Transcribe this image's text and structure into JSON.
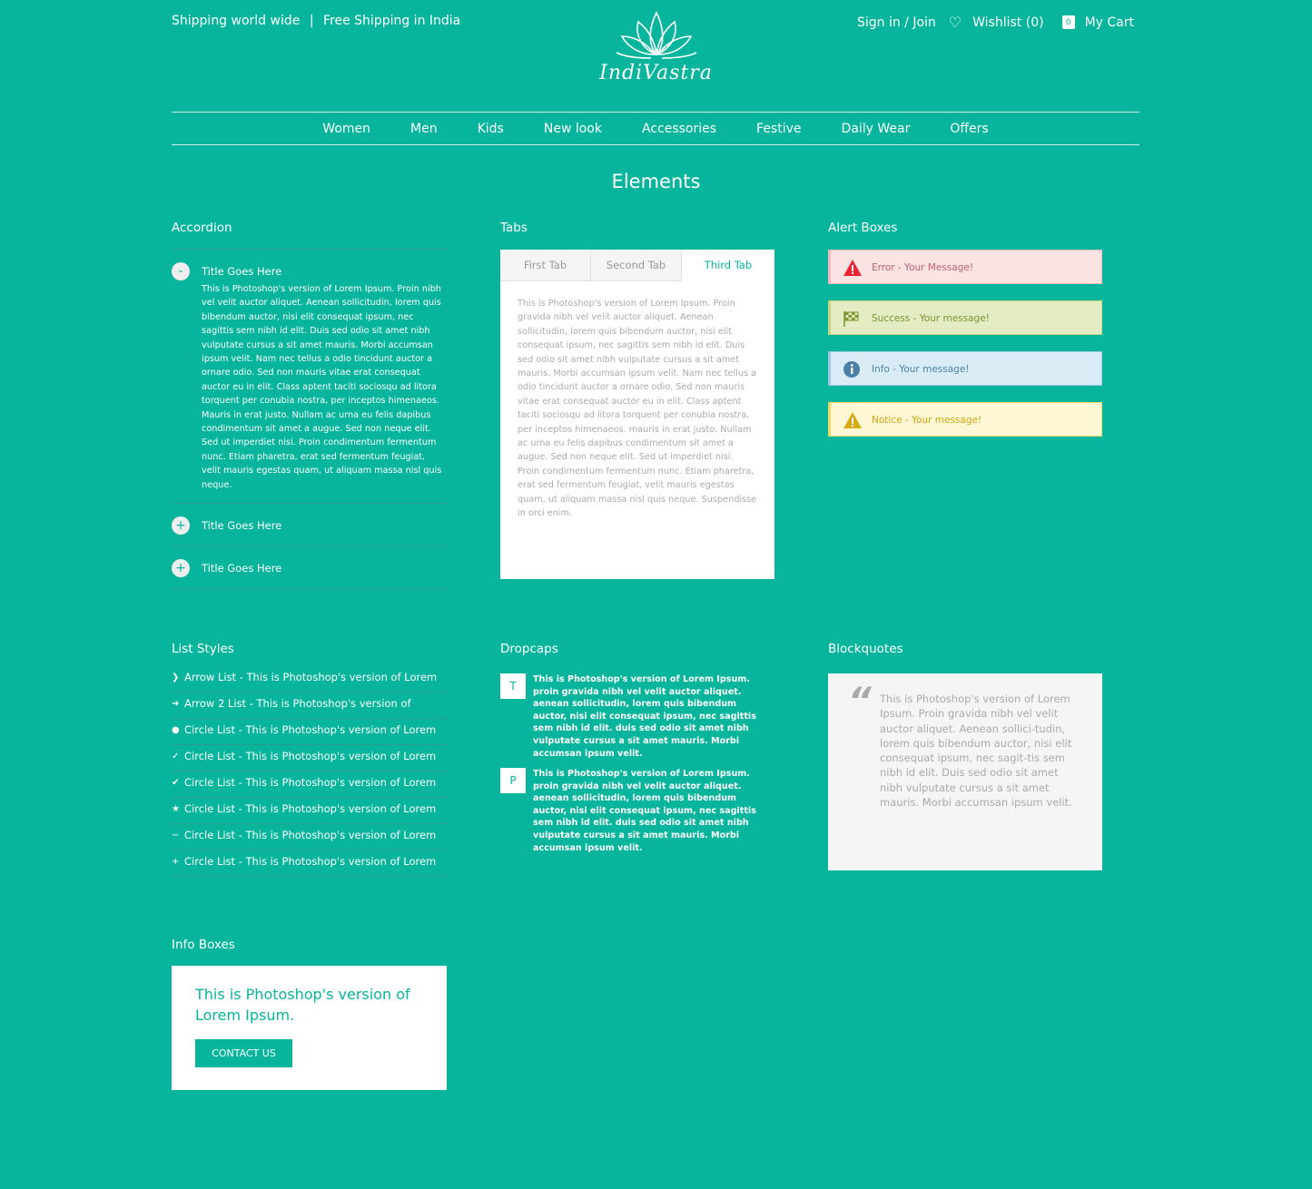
{
  "header": {
    "shipping": "Shipping world wide",
    "separator": "|",
    "free_shipping": "Free Shipping in India",
    "brand": "IndiVastra",
    "signin": "Sign in / Join",
    "wishlist": "Wishlist (0)",
    "cart_count": "0",
    "cart": "My Cart"
  },
  "nav": [
    "Women",
    "Men",
    "Kids",
    "New look",
    "Accessories",
    "Festive",
    "Daily Wear",
    "Offers"
  ],
  "page_title": "Elements",
  "accordion": {
    "heading": "Accordion",
    "items": [
      {
        "icon": "-",
        "title": "Title Goes Here",
        "body": "This is Photoshop's version  of Lorem Ipsum. Proin nibh vel velit auctor aliquet. Aenean sollicitudin, lorem quis bibendum auctor, nisi elit consequat ipsum, nec sagittis sem nibh id elit. Duis sed odio sit amet nibh vulputate cursus a sit amet mauris. Morbi accumsan ipsum velit. Nam nec tellus a odio tincidunt auctor a ornare odio. Sed non  mauris vitae erat consequat auctor eu in elit. Class aptent taciti sociosqu ad litora torquent per conubia nostra, per inceptos himenaeos. Mauris in erat justo. Nullam ac urna eu felis dapibus condimentum sit amet a augue. Sed non neque elit. Sed ut imperdiet nisi. Proin condimentum fermentum nunc. Etiam pharetra, erat sed fermentum feugiat, velit mauris egestas quam, ut aliquam massa nisl quis neque."
      },
      {
        "icon": "+",
        "title": "Title Goes Here"
      },
      {
        "icon": "+",
        "title": "Title Goes Here"
      }
    ]
  },
  "tabs": {
    "heading": "Tabs",
    "labels": [
      "First Tab",
      "Second Tab",
      "Third Tab"
    ],
    "active": "Third Tab",
    "body": "This is Photoshop's version  of Lorem Ipsum. Proin gravida nibh vel velit auctor aliquet. Aenean sollicitudin, lorem quis bibendum auctor, nisi elit consequat ipsum, nec sagittis sem nibh id elit. Duis sed odio sit amet nibh vulputate cursus a sit amet mauris. Morbi accumsan ipsum velit. Nam nec tellus a odio tincidunt auctor a ornare odio. Sed non  mauris vitae erat consequat auctor eu in elit. Class aptent taciti sociosqu ad litora torquent per conubia nostra, per inceptos himenaeos. mauris in erat justo. Nullam ac urna eu felis dapibus condimentum sit amet a augue. Sed non neque elit. Sed ut imperdiet nisi. Proin condimentum fermentum nunc. Etiam pharetra, erat sed fermentum feugiat, velit mauris egestas quam, ut aliquam massa nisl quis neque. Suspendisse in orci enim."
  },
  "alerts": {
    "heading": "Alert Boxes",
    "items": [
      {
        "type": "error",
        "text": "Error - Your Message!",
        "bg": "#fbe3e4",
        "border": "#f4b8bc",
        "color": "#c0626d"
      },
      {
        "type": "success",
        "text": "Success - Your message!",
        "bg": "#e4ecc4",
        "border": "#c6d880",
        "color": "#7a962e"
      },
      {
        "type": "info",
        "text": "Info - Your message!",
        "bg": "#d9ecf6",
        "border": "#9fc7e3",
        "color": "#4a81a8"
      },
      {
        "type": "notice",
        "text": "Notice - Your message!",
        "bg": "#fdf7d6",
        "border": "#f0d864",
        "color": "#d0a60f"
      }
    ]
  },
  "lists": {
    "heading": "List Styles",
    "items": [
      {
        "bullet": "❯",
        "text": "Arrow List - This is Photoshop's version  of Lorem"
      },
      {
        "bullet": "➜",
        "text": "Arrow 2 List  - This is Photoshop's version  of"
      },
      {
        "bullet": "●",
        "text": "Circle List  - This is Photoshop's version  of Lorem"
      },
      {
        "bullet": "✓",
        "text": "Circle List  - This is Photoshop's version  of Lorem"
      },
      {
        "bullet": "✔",
        "text": "Circle List  - This is Photoshop's version  of Lorem"
      },
      {
        "bullet": "★",
        "text": "Circle List  - This is Photoshop's version  of Lorem"
      },
      {
        "bullet": "−",
        "text": "Circle List  - This is Photoshop's version  of Lorem"
      },
      {
        "bullet": "+",
        "text": "Circle List  - This is Photoshop's version  of Lorem"
      }
    ]
  },
  "dropcaps": {
    "heading": "Dropcaps",
    "items": [
      {
        "cap": "T",
        "text": "This is Photoshop's version  of Lorem Ipsum. proin gravida nibh vel velit auctor aliquet. aenean sollicitudin, lorem quis bibendum auctor, nisi elit consequat ipsum, nec sagittis sem nibh id elit. duis sed odio sit amet nibh vulputate cursus a sit amet mauris. Morbi accumsan ipsum velit."
      },
      {
        "cap": "P",
        "text": "This is Photoshop's version  of Lorem Ipsum. proin gravida nibh vel velit auctor aliquet. aenean sollicitudin, lorem quis bibendum auctor, nisi elit consequat ipsum, nec sagittis sem nibh id elit. duis sed odio sit amet nibh vulputate cursus a sit amet mauris. Morbi accumsan ipsum velit."
      }
    ]
  },
  "blockquote": {
    "heading": "Blockquotes",
    "quote_mark": "“",
    "text": "This is Photoshop's version  of Lorem Ipsum. Proin gravida nibh vel velit auctor aliquet. Aenean sollici-tudin, lorem quis bibendum auctor, nisi elit consequat ipsum, nec sagit-tis sem nibh id elit. Duis sed odio sit amet nibh vulputate cursus a sit amet mauris. Morbi accumsan ipsum velit."
  },
  "infobox": {
    "heading": "Info Boxes",
    "title": "This is Photoshop's version  of Lorem Ipsum.",
    "button": "CONTACT US"
  },
  "colors": {
    "background": "#07b59c",
    "accent": "#07b59c"
  }
}
